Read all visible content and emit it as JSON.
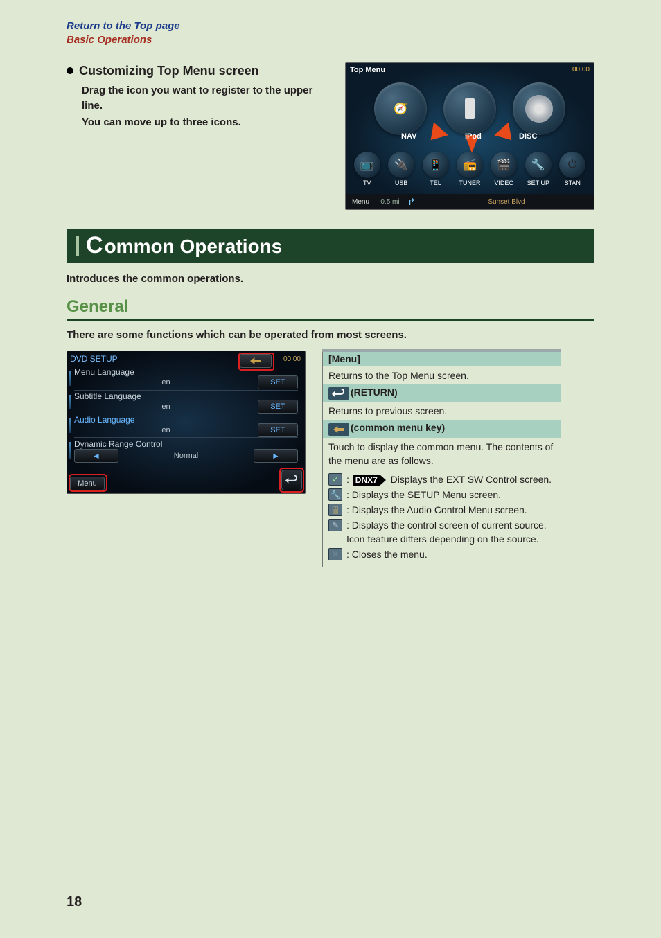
{
  "breadcrumbs": {
    "top": "Return to the Top page",
    "basic": "Basic Operations"
  },
  "customize": {
    "heading": "Customizing Top Menu screen",
    "line1": "Drag the icon you want to register to the upper line.",
    "line2": "You can move up to three icons."
  },
  "topmenu_shot": {
    "title": "Top Menu",
    "clock": "00:00",
    "big_labels": {
      "nav": "NAV",
      "ipod": "iPod",
      "disc": "DISC"
    },
    "small": [
      "TV",
      "USB",
      "TEL",
      "TUNER",
      "VIDEO",
      "SET UP",
      "STAN"
    ],
    "nav": {
      "menu": "Menu",
      "dist": "0.5 mi",
      "street": "Sunset Blvd"
    }
  },
  "h1": {
    "big": "C",
    "rest": "ommon Operations"
  },
  "intro": "Introduces the common operations.",
  "h2": "General",
  "sub": "There are some functions which can be operated from most screens.",
  "dvd": {
    "title": "DVD SETUP",
    "clock": "00:00",
    "rows": [
      {
        "label": "Menu Language",
        "value": "en",
        "set": "SET"
      },
      {
        "label": "Subtitle Language",
        "value": "en",
        "set": "SET"
      },
      {
        "label": "Audio Language",
        "value": "en",
        "set": "SET"
      }
    ],
    "range": {
      "label": "Dynamic Range Control",
      "value": "Normal"
    },
    "menu": "Menu"
  },
  "desc": {
    "menu_h": "[Menu]",
    "menu_b": "Returns to the Top Menu screen.",
    "ret_h": "(RETURN)",
    "ret_b": "Returns to previous screen.",
    "key_h": "(common menu key)",
    "key_b": "Touch to display the common menu. The contents of the menu are as follows.",
    "dnx": "DNX7",
    "items": {
      "sw": " Displays the EXT SW Control screen.",
      "setup": ": Displays the SETUP Menu screen.",
      "audio": ": Displays the Audio Control Menu screen.",
      "source": ": Displays the control screen of current source. Icon feature differs depending on the source.",
      "close": ": Closes the menu."
    }
  },
  "page": "18"
}
